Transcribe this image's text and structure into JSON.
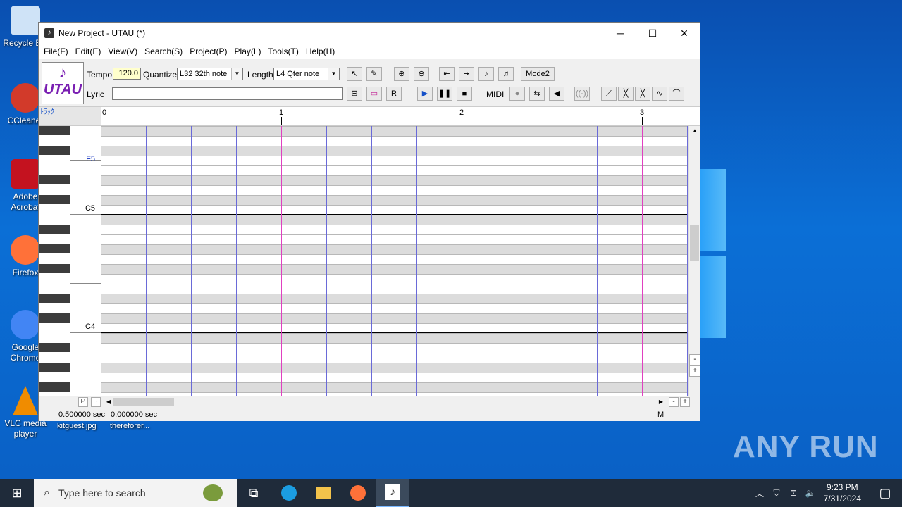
{
  "desktop": {
    "icons": [
      {
        "label": "Recycle Bin",
        "color": "#cfe3f7"
      },
      {
        "label": "CCleaner",
        "color": "#d23a2a"
      },
      {
        "label": "Adobe Acrobat",
        "color": "#c4121f"
      },
      {
        "label": "Firefox",
        "color": "#ff7139"
      },
      {
        "label": "Google Chrome",
        "color": "#4285f4"
      },
      {
        "label": "VLC media player",
        "color": "#f08c00"
      }
    ],
    "watermark": "ANY RUN"
  },
  "window": {
    "title": "New Project - UTAU (*)",
    "minimize": "─",
    "maximize": "☐",
    "close": "✕",
    "menu": [
      "File(F)",
      "Edit(E)",
      "View(V)",
      "Search(S)",
      "Project(P)",
      "Play(L)",
      "Tools(T)",
      "Help(H)"
    ]
  },
  "toolbar": {
    "logo": "UTAU",
    "tempo_label": "Tempo",
    "tempo_value": "120.0",
    "quantize_label": "Quantize",
    "quantize_value": "L32 32th note",
    "length_label": "Length",
    "length_value": "L4  Qter note",
    "lyric_label": "Lyric",
    "lyric_value": "",
    "mode_button": "Mode2",
    "midi_label": "MIDI"
  },
  "ruler": {
    "corner": "ﾄﾗｯｸ",
    "measures": [
      "0",
      "1",
      "2",
      "3"
    ]
  },
  "piano": {
    "labels": [
      "F5",
      "C5",
      "C4"
    ]
  },
  "statusbar": {
    "time1": "0.500000 sec",
    "time2": "0.000000 sec",
    "file1": "kitguest.jpg",
    "file2": "thereforer...",
    "mode": "M"
  },
  "taskbar": {
    "search_placeholder": "Type here to search",
    "time": "9:23 PM",
    "date": "7/31/2024"
  }
}
